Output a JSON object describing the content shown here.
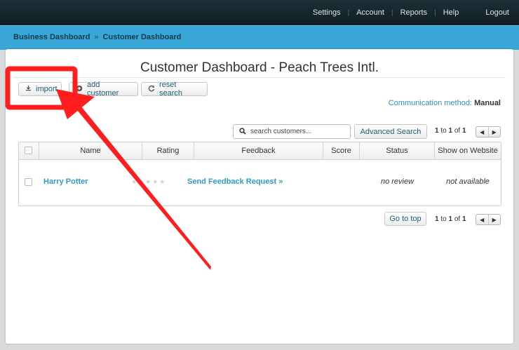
{
  "topnav": {
    "items": [
      "Settings",
      "Account",
      "Reports",
      "Help"
    ],
    "logout": "Logout"
  },
  "breadcrumb": {
    "items": [
      "Business Dashboard",
      "Customer Dashboard"
    ],
    "separator": "»"
  },
  "page": {
    "title": "Customer Dashboard - Peach Trees Intl."
  },
  "toolbar": {
    "import_label": "import",
    "add_customer_label": "add customer",
    "reset_search_label": "reset search"
  },
  "communication": {
    "label": "Communication method:",
    "value": "Manual"
  },
  "search": {
    "placeholder": "search customers...",
    "advanced_label": "Advanced Search"
  },
  "pager": {
    "from": "1",
    "to_word": "to",
    "to": "1",
    "of_word": "of",
    "total": "1"
  },
  "table": {
    "columns": [
      "Name",
      "Rating",
      "Feedback",
      "Score",
      "Status",
      "Show on Website"
    ],
    "rows": [
      {
        "name": "Harry Potter",
        "rating_stars": "★★★★★",
        "feedback": "Send Feedback Request »",
        "score": "",
        "status": "no review",
        "show_on_website": "not available"
      }
    ]
  },
  "footer": {
    "go_to_top_label": "Go to top"
  },
  "colors": {
    "topbar": "#13252b",
    "crumbbar": "#3aa6d6",
    "link": "#2f9bc6",
    "annotation": "#ff1d1d"
  },
  "icons": {
    "import": "download-icon",
    "add_customer": "plus-circle-icon",
    "reset_search": "refresh-icon",
    "search": "search-icon",
    "pager_prev": "triangle-left-icon",
    "pager_next": "triangle-right-icon"
  }
}
